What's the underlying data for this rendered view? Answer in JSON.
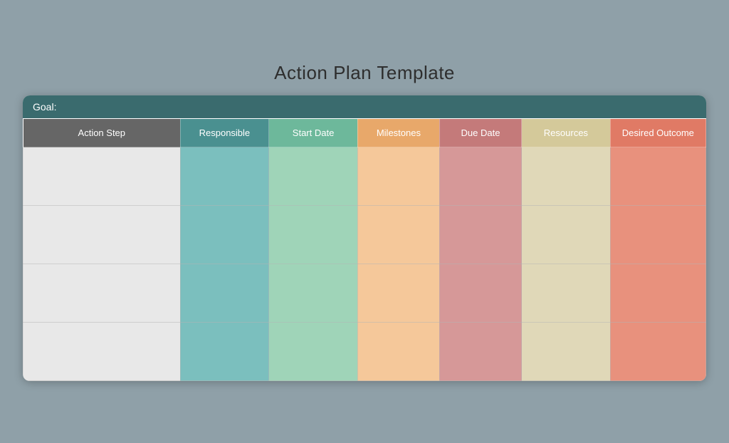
{
  "title": "Action Plan Template",
  "goal_label": "Goal:",
  "columns": [
    {
      "id": "action",
      "label": "Action Step",
      "header_class": "col-action",
      "cell_class": "cell-action"
    },
    {
      "id": "resp",
      "label": "Responsible",
      "header_class": "col-resp",
      "cell_class": "cell-resp"
    },
    {
      "id": "start",
      "label": "Start Date",
      "header_class": "col-start",
      "cell_class": "cell-start"
    },
    {
      "id": "mile",
      "label": "Milestones",
      "header_class": "col-mile",
      "cell_class": "cell-mile"
    },
    {
      "id": "due",
      "label": "Due Date",
      "header_class": "col-due",
      "cell_class": "cell-due"
    },
    {
      "id": "res",
      "label": "Resources",
      "header_class": "col-res",
      "cell_class": "cell-res"
    },
    {
      "id": "desired",
      "label": "Desired Outcome",
      "header_class": "col-desired",
      "cell_class": "cell-desired"
    }
  ],
  "rows": [
    {
      "id": 1
    },
    {
      "id": 2
    },
    {
      "id": 3
    },
    {
      "id": 4
    }
  ]
}
